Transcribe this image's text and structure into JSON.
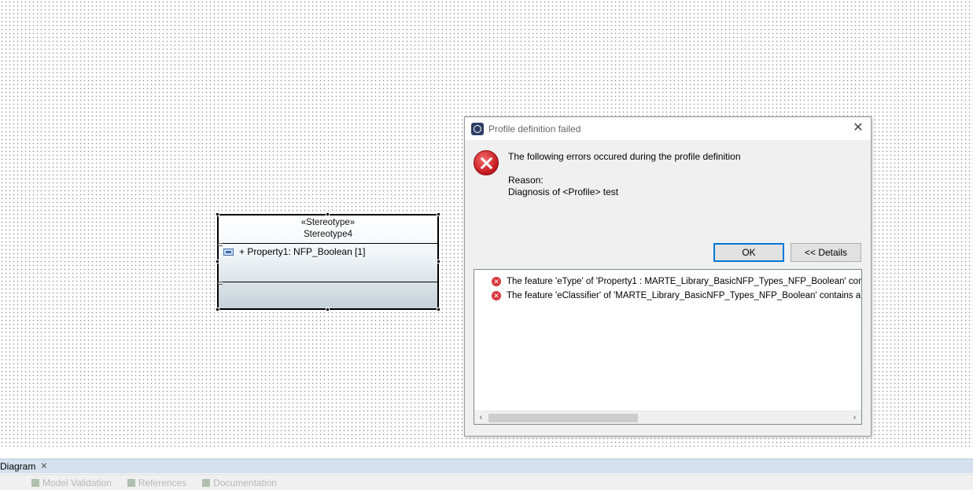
{
  "uml_box": {
    "stereotype": "«Stereotype»",
    "name": "Stereotype4",
    "property": "+ Property1: NFP_Boolean [1]"
  },
  "dialog": {
    "title": "Profile definition failed",
    "message": "The following errors occured during the profile definition",
    "reason_label": "Reason:",
    "reason_text": "Diagnosis of <Profile> test",
    "ok_label": "OK",
    "details_label": "<< Details",
    "errors": [
      "The feature 'eType' of 'Property1 : MARTE_Library_BasicNFP_Types_NFP_Boolean' contains a dangling reference",
      "The feature 'eClassifier' of 'MARTE_Library_BasicNFP_Types_NFP_Boolean' contains a dangling reference"
    ]
  },
  "editor_tab": {
    "label": "Diagram"
  },
  "views": [
    "Model Validation",
    "References",
    "Documentation"
  ]
}
